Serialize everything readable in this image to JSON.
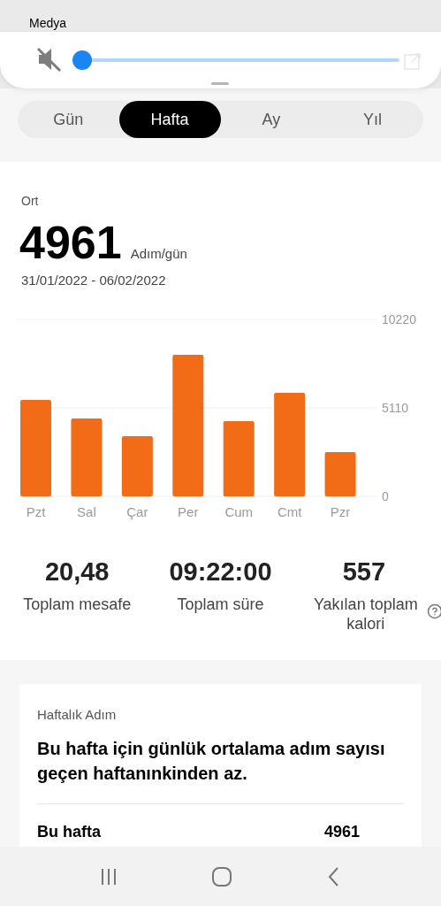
{
  "volume_panel": {
    "label": "Medya",
    "muted": true,
    "level": 0
  },
  "tabs": [
    {
      "label": "Gün",
      "selected": false
    },
    {
      "label": "Hafta",
      "selected": true
    },
    {
      "label": "Ay",
      "selected": false
    },
    {
      "label": "Yıl",
      "selected": false
    }
  ],
  "summary": {
    "caption": "Ort",
    "value": "4961",
    "unit": "Adım/gün",
    "date_range": "31/01/2022 - 06/02/2022",
    "chart_data": {
      "type": "bar",
      "categories": [
        "Pzt",
        "Sal",
        "Çar",
        "Per",
        "Cum",
        "Cmt",
        "Pzr"
      ],
      "series": [
        {
          "color": "#f26b16",
          "values": [
            5570,
            4500,
            3480,
            8180,
            4340,
            5980,
            2560
          ]
        }
      ],
      "ylim": [
        0,
        10220
      ],
      "yticks": [
        0,
        5110,
        10220
      ]
    }
  },
  "stats": [
    {
      "value": "20,48",
      "label": "Toplam mesafe",
      "help": false
    },
    {
      "value": "09:22:00",
      "label": "Toplam süre",
      "help": false
    },
    {
      "value": "557",
      "label": "Yakılan toplam kalori",
      "help": true
    }
  ],
  "weekly": {
    "caption": "Haftalık Adım",
    "message": "Bu hafta için günlük ortalama adım sayısı geçen haftanınkinden az.",
    "rows": [
      {
        "label": "Bu hafta",
        "value": "4961"
      }
    ]
  }
}
